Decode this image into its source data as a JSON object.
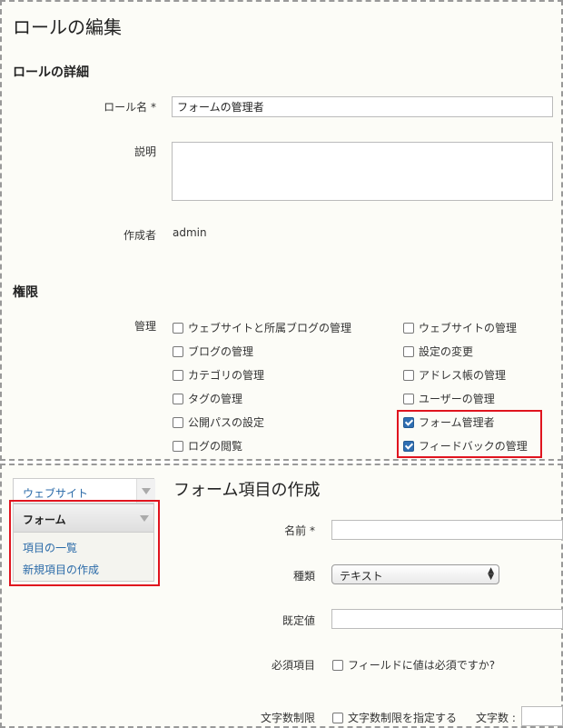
{
  "role_edit": {
    "title": "ロールの編集",
    "details_heading": "ロールの詳細",
    "role_name_label": "ロール名 *",
    "role_name_value": "フォームの管理者",
    "description_label": "説明",
    "creator_label": "作成者",
    "creator_value": "admin",
    "permissions_heading": "権限",
    "admin_label": "管理",
    "permissions_left": [
      {
        "label": "ウェブサイトと所属ブログの管理",
        "checked": false
      },
      {
        "label": "ブログの管理",
        "checked": false
      },
      {
        "label": "カテゴリの管理",
        "checked": false
      },
      {
        "label": "タグの管理",
        "checked": false
      },
      {
        "label": "公開パスの設定",
        "checked": false
      },
      {
        "label": "ログの閲覧",
        "checked": false
      }
    ],
    "permissions_right": [
      {
        "label": "ウェブサイトの管理",
        "checked": false
      },
      {
        "label": "設定の変更",
        "checked": false
      },
      {
        "label": "アドレス帳の管理",
        "checked": false
      },
      {
        "label": "ユーザーの管理",
        "checked": false
      },
      {
        "label": "フォーム管理者",
        "checked": true
      },
      {
        "label": "フィードバックの管理",
        "checked": true
      }
    ]
  },
  "form_create": {
    "sidebar": {
      "website_label": "ウェブサイト",
      "form_label": "フォーム",
      "items": [
        "項目の一覧",
        "新規項目の作成"
      ]
    },
    "title": "フォーム項目の作成",
    "name_label": "名前 *",
    "type_label": "種類",
    "type_value": "テキスト",
    "default_label": "既定値",
    "required_label": "必須項目",
    "required_checkbox": "フィールドに値は必須ですか?",
    "length_label": "文字数制限",
    "length_checkbox": "文字数制限を指定する",
    "char_count_label": "文字数 :"
  },
  "colors": {
    "highlight": "#e0141e",
    "link": "#2a6aa8",
    "background": "#fcfcf7"
  }
}
